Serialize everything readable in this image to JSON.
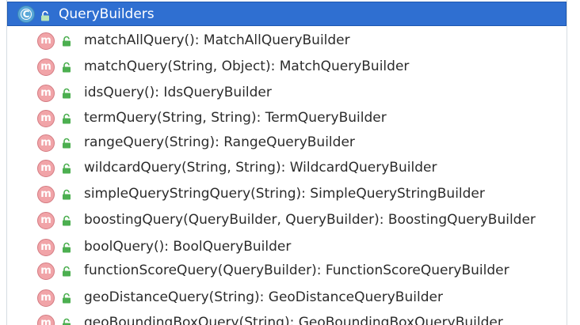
{
  "header": {
    "title": "QueryBuilders",
    "icon": "class-icon",
    "icon_letter": "C"
  },
  "method_icon_letter": "m",
  "methods": [
    "matchAllQuery(): MatchAllQueryBuilder",
    "matchQuery(String, Object): MatchQueryBuilder",
    "idsQuery(): IdsQueryBuilder",
    "termQuery(String, String): TermQueryBuilder",
    "rangeQuery(String): RangeQueryBuilder",
    "wildcardQuery(String, String): WildcardQueryBuilder",
    "simpleQueryStringQuery(String): SimpleQueryStringBuilder",
    "boostingQuery(QueryBuilder, QueryBuilder): BoostingQueryBuilder",
    "boolQuery(): BoolQueryBuilder",
    "functionScoreQuery(QueryBuilder): FunctionScoreQueryBuilder",
    "geoDistanceQuery(String): GeoDistanceQueryBuilder",
    "geoBoundingBoxQuery(String): GeoBoundingBoxQueryBuilder"
  ],
  "colors": {
    "header_bg": "#2f6fd1",
    "method_icon": "#f1a4a8",
    "lock_green": "#4caf50"
  }
}
